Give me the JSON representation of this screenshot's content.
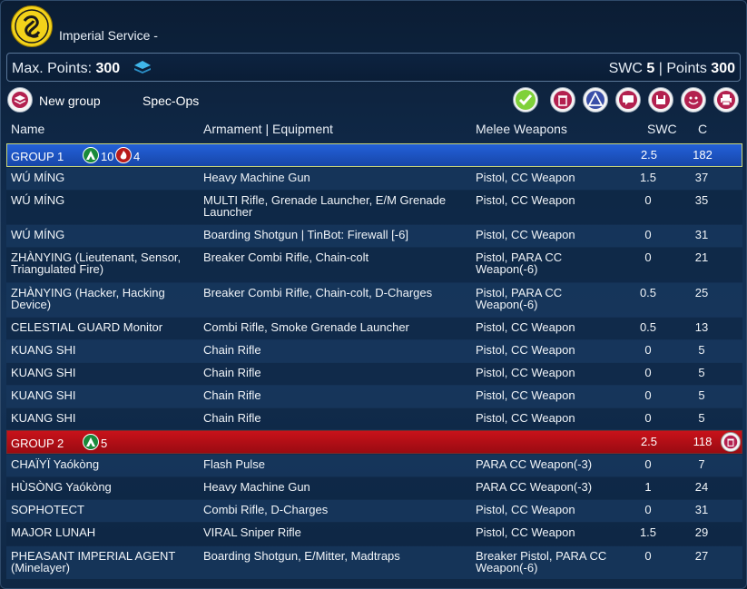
{
  "header": {
    "title": "Imperial Service -",
    "logo_icon": "imperial-service-logo"
  },
  "points": {
    "max_label": "Max. Points:",
    "max_value": "300",
    "swc_label": "SWC",
    "swc_value": "5",
    "separator": "|",
    "points_label": "Points",
    "points_value": "300"
  },
  "toolbar": {
    "new_group_label": "New group",
    "spec_ops_label": "Spec-Ops"
  },
  "columns": {
    "name": "Name",
    "armament": "Armament | Equipment",
    "melee": "Melee Weapons",
    "swc": "SWC",
    "c": "C"
  },
  "group1": {
    "name": "GROUP 1",
    "orders_regular": "10",
    "orders_impetuous": "4",
    "swc": "2.5",
    "c": "182",
    "units": [
      {
        "name": "WÚ MÍNG",
        "armament": "Heavy Machine Gun",
        "melee": "Pistol, CC Weapon",
        "swc": "1.5",
        "c": "37"
      },
      {
        "name": "WÚ MÍNG",
        "armament": "MULTI Rifle, Grenade Launcher, E/M Grenade Launcher",
        "melee": "Pistol, CC Weapon",
        "swc": "0",
        "c": "35"
      },
      {
        "name": "WÚ MÍNG",
        "armament": "Boarding Shotgun | TinBot: Firewall [-6]",
        "melee": "Pistol, CC Weapon",
        "swc": "0",
        "c": "31"
      },
      {
        "name": "ZHÀNYING (Lieutenant, Sensor, Triangulated Fire)",
        "armament": "Breaker Combi Rifle, Chain-colt",
        "melee": "Pistol, PARA CC Weapon(-6)",
        "swc": "0",
        "c": "21"
      },
      {
        "name": "ZHÀNYING (Hacker, Hacking Device)",
        "armament": "Breaker Combi Rifle, Chain-colt, D-Charges",
        "melee": "Pistol, PARA CC Weapon(-6)",
        "swc": "0.5",
        "c": "25"
      },
      {
        "name": "CELESTIAL GUARD Monitor",
        "armament": "Combi Rifle, Smoke Grenade Launcher",
        "melee": "Pistol, CC Weapon",
        "swc": "0.5",
        "c": "13"
      },
      {
        "name": "KUANG SHI",
        "armament": "Chain Rifle",
        "melee": "Pistol, CC Weapon",
        "swc": "0",
        "c": "5"
      },
      {
        "name": "KUANG SHI",
        "armament": "Chain Rifle",
        "melee": "Pistol, CC Weapon",
        "swc": "0",
        "c": "5"
      },
      {
        "name": "KUANG SHI",
        "armament": "Chain Rifle",
        "melee": "Pistol, CC Weapon",
        "swc": "0",
        "c": "5"
      },
      {
        "name": "KUANG SHI",
        "armament": "Chain Rifle",
        "melee": "Pistol, CC Weapon",
        "swc": "0",
        "c": "5"
      }
    ]
  },
  "group2": {
    "name": "GROUP 2",
    "orders_regular": "5",
    "swc": "2.5",
    "c": "118",
    "units": [
      {
        "name": "CHAÏYÏ Yaókòng",
        "armament": "Flash Pulse",
        "melee": "PARA CC Weapon(-3)",
        "swc": "0",
        "c": "7"
      },
      {
        "name": "HÙSÒNG Yaókòng",
        "armament": "Heavy Machine Gun",
        "melee": "PARA CC Weapon(-3)",
        "swc": "1",
        "c": "24"
      },
      {
        "name": "SOPHOTECT",
        "armament": "Combi Rifle, D-Charges",
        "melee": "Pistol, CC Weapon",
        "swc": "0",
        "c": "31"
      },
      {
        "name": "MAJOR LUNAH",
        "armament": "VIRAL Sniper Rifle",
        "melee": "Pistol, CC Weapon",
        "swc": "1.5",
        "c": "29"
      },
      {
        "name": "PHEASANT IMPERIAL AGENT (Minelayer)",
        "armament": "Boarding Shotgun, E/Mitter, Madtraps",
        "melee": "Breaker Pistol, PARA CC Weapon(-6)",
        "swc": "0",
        "c": "27"
      }
    ]
  },
  "colors": {
    "group1_bg": "#1f55c4",
    "group2_bg": "#b5111a",
    "logo_yellow": "#f3d21a"
  }
}
